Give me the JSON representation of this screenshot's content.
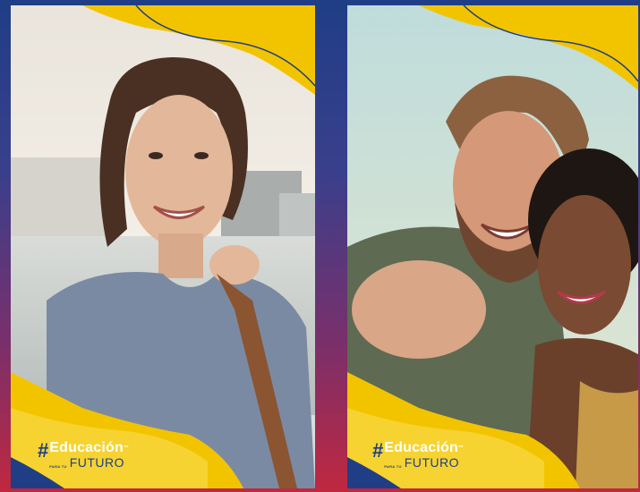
{
  "photos": [
    {
      "hashtag": "#",
      "brand_main": "Educación",
      "trademark": "™",
      "brand_small": "PARA TU",
      "brand_future": "FUTURO"
    },
    {
      "hashtag": "#",
      "brand_main": "Educación",
      "trademark": "™",
      "brand_small": "PARA TU",
      "brand_future": "FUTURO"
    }
  ],
  "colors": {
    "brand_blue": "#1f3e86",
    "brand_yellow": "#f2c400",
    "divider_top": "#1f3e86",
    "divider_bottom": "#c0283f"
  }
}
